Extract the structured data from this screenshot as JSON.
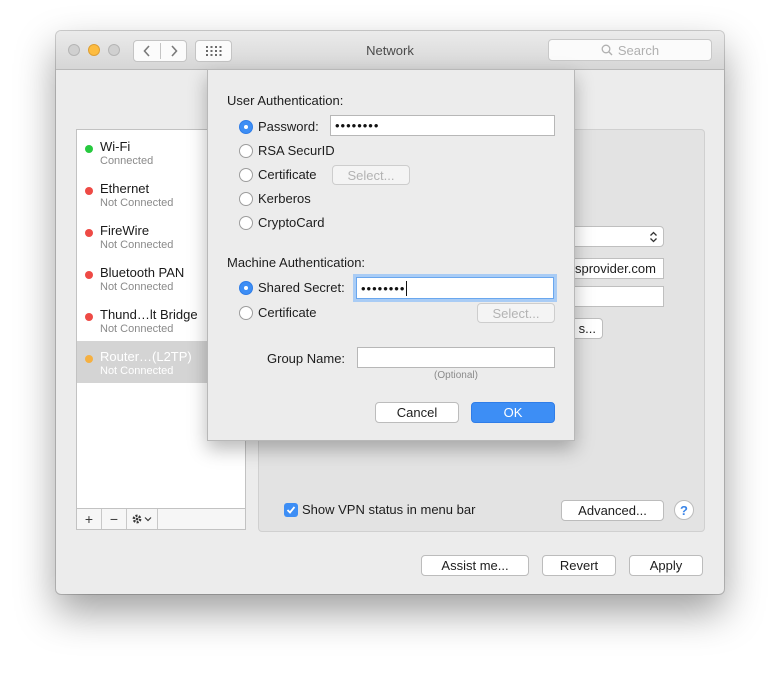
{
  "window": {
    "title": "Network",
    "search_placeholder": "Search"
  },
  "sidebar": {
    "items": [
      {
        "name": "Wi-Fi",
        "status": "Connected",
        "dot_color": "#27c93f"
      },
      {
        "name": "Ethernet",
        "status": "Not Connected",
        "dot_color": "#ee4a45"
      },
      {
        "name": "FireWire",
        "status": "Not Connected",
        "dot_color": "#ee4a45"
      },
      {
        "name": "Bluetooth PAN",
        "status": "Not Connected",
        "dot_color": "#ee4a45"
      },
      {
        "name": "Thund…lt Bridge",
        "status": "Not Connected",
        "dot_color": "#ee4a45"
      },
      {
        "name": "Router…(L2TP)",
        "status": "Not Connected",
        "dot_color": "#f5b041",
        "selected": true
      }
    ],
    "toolbar": {
      "add": "+",
      "remove": "−",
      "action_icon": "gear-icon"
    }
  },
  "main": {
    "server_address_partial": "sprovider.com",
    "auth_settings_partial": "s...",
    "show_vpn_status_label": "Show VPN status in menu bar",
    "show_vpn_status_checked": true,
    "advanced_button": "Advanced...",
    "help_button": "?"
  },
  "sheet": {
    "user_auth_heading": "User Authentication:",
    "user_auth_options": [
      {
        "label": "Password:",
        "selected": true
      },
      {
        "label": "RSA SecurID",
        "selected": false
      },
      {
        "label": "Certificate",
        "selected": false
      },
      {
        "label": "Kerberos",
        "selected": false
      },
      {
        "label": "CryptoCard",
        "selected": false
      }
    ],
    "password_value": "••••••••",
    "certificate_select_button": "Select...",
    "machine_auth_heading": "Machine Authentication:",
    "machine_auth_options": [
      {
        "label": "Shared Secret:",
        "selected": true
      },
      {
        "label": "Certificate",
        "selected": false
      }
    ],
    "shared_secret_value": "••••••••",
    "machine_certificate_select_button": "Select...",
    "group_name_label": "Group Name:",
    "group_name_value": "",
    "group_name_hint": "(Optional)",
    "cancel_button": "Cancel",
    "ok_button": "OK"
  },
  "footer": {
    "assist_button": "Assist me...",
    "revert_button": "Revert",
    "apply_button": "Apply"
  },
  "colors": {
    "accent_blue": "#3d8ef5",
    "connected_green": "#27c93f",
    "disconnected_red": "#ee4a45",
    "pending_orange": "#f5b041"
  }
}
